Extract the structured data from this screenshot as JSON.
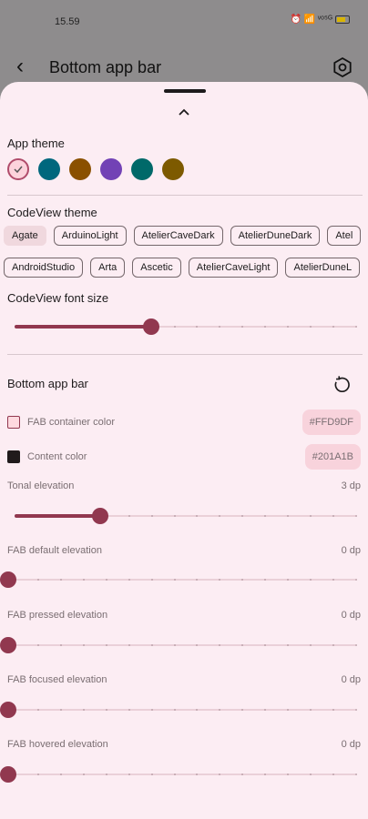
{
  "status": {
    "time": "15.59",
    "icons": "⏰ 📶 ᵛᵒ⁵ᴳ"
  },
  "appbar": {
    "title": "Bottom app bar",
    "back": "‹"
  },
  "app_theme": {
    "label": "App theme",
    "swatches": [
      "#fcd3dc",
      "#00677d",
      "#8a5000",
      "#7242b5",
      "#006969",
      "#7d5a00"
    ],
    "selected_index": 0
  },
  "codeview": {
    "label": "CodeView theme",
    "row1": [
      "Agate",
      "ArduinoLight",
      "AtelierCaveDark",
      "AtelierDuneDark",
      "Atel"
    ],
    "row2": [
      "AndroidStudio",
      "Arta",
      "Ascetic",
      "AtelierCaveLight",
      "AtelierDuneL"
    ],
    "active": "Agate"
  },
  "font_size": {
    "label": "CodeView font size",
    "level": 0.4
  },
  "bottom_bar": {
    "label": "Bottom app bar",
    "fab_container": {
      "label": "FAB container color",
      "hex": "#FFD9DF",
      "swatch": "#ffd9df"
    },
    "content": {
      "label": "Content color",
      "hex": "#201A1B",
      "swatch": "#201a1b"
    },
    "tonal": {
      "label": "Tonal elevation",
      "value": "3 dp",
      "level": 0.25
    },
    "fab_default": {
      "label": "FAB default elevation",
      "value": "0 dp",
      "level": 0
    },
    "fab_pressed": {
      "label": "FAB pressed elevation",
      "value": "0 dp",
      "level": 0
    },
    "fab_focused": {
      "label": "FAB focused elevation",
      "value": "0 dp",
      "level": 0
    },
    "fab_hovered": {
      "label": "FAB hovered elevation",
      "value": "0 dp",
      "level": 0
    }
  }
}
